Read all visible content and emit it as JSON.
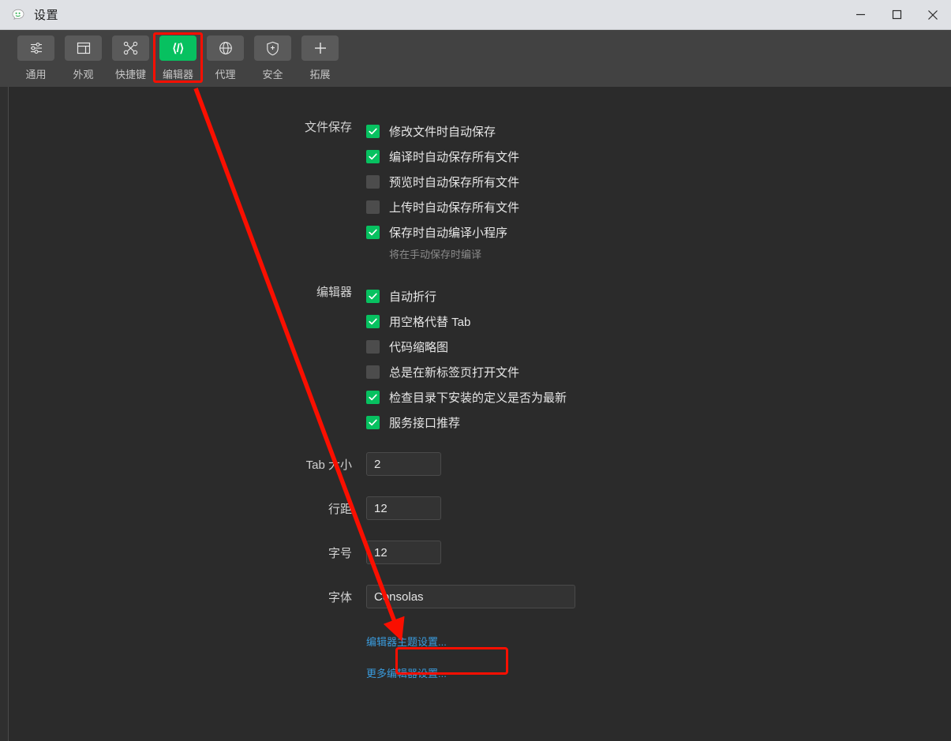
{
  "window": {
    "title": "设置",
    "app_icon": "wechat-bubble-icon",
    "controls": {
      "minimize": "—",
      "maximize": "□",
      "close": "✕"
    }
  },
  "toolbar": {
    "items": [
      {
        "label": "通用",
        "icon": "sliders-icon",
        "active": false
      },
      {
        "label": "外观",
        "icon": "window-icon",
        "active": false
      },
      {
        "label": "快捷键",
        "icon": "keyboard-key-icon",
        "active": false
      },
      {
        "label": "编辑器",
        "icon": "code-brackets-icon",
        "active": true
      },
      {
        "label": "代理",
        "icon": "globe-icon",
        "active": false
      },
      {
        "label": "安全",
        "icon": "shield-plus-icon",
        "active": false
      },
      {
        "label": "拓展",
        "icon": "plus-icon",
        "active": false
      }
    ]
  },
  "sections": {
    "file_save": {
      "label": "文件保存",
      "checkboxes": [
        {
          "label": "修改文件时自动保存",
          "checked": true
        },
        {
          "label": "编译时自动保存所有文件",
          "checked": true
        },
        {
          "label": "预览时自动保存所有文件",
          "checked": false
        },
        {
          "label": "上传时自动保存所有文件",
          "checked": false
        },
        {
          "label": "保存时自动编译小程序",
          "checked": true
        }
      ],
      "hint": "将在手动保存时编译"
    },
    "editor": {
      "label": "编辑器",
      "checkboxes": [
        {
          "label": "自动折行",
          "checked": true
        },
        {
          "label": "用空格代替 Tab",
          "checked": true
        },
        {
          "label": "代码缩略图",
          "checked": false
        },
        {
          "label": "总是在新标签页打开文件",
          "checked": false
        },
        {
          "label": "检查目录下安装的定义是否为最新",
          "checked": true
        },
        {
          "label": "服务接口推荐",
          "checked": true
        }
      ]
    }
  },
  "fields": [
    {
      "label": "Tab 大小",
      "value": "2",
      "size": "small"
    },
    {
      "label": "行距",
      "value": "12",
      "size": "small"
    },
    {
      "label": "字号",
      "value": "12",
      "size": "small"
    },
    {
      "label": "字体",
      "value": "Consolas",
      "size": "wide"
    }
  ],
  "links": [
    {
      "label": "编辑器主题设置...",
      "highlighted": false
    },
    {
      "label": "更多编辑器设置...",
      "highlighted": true
    }
  ],
  "annotations": {
    "highlight_color": "#fa0f00",
    "arrow": "points from 编辑器 toolbar tab down to 更多编辑器设置 link"
  },
  "colors": {
    "accent_green": "#07c160",
    "content_bg": "#2b2b2b",
    "toolbar_bg": "#424242",
    "titlebar_bg": "#dfe1e5",
    "link_blue": "#3a9bdc"
  }
}
